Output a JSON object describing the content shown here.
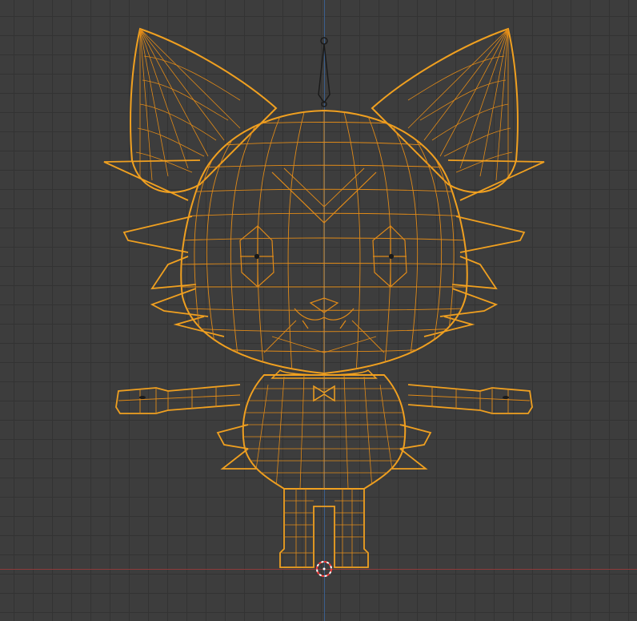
{
  "viewport": {
    "view": "front-orthographic",
    "colors": {
      "background": "#3d3d3d",
      "grid": "#333333",
      "x_axis": "#8e3a3a",
      "z_axis": "#3a5f8e",
      "wire_selected": "#f0a020",
      "wire_inner": "#e08a18",
      "armature": "#1a1a1a",
      "cursor_red": "#ff3a3a",
      "cursor_white": "#ffffff"
    }
  },
  "object": {
    "type": "character-mesh",
    "subject": "cat-mascot",
    "selected": true,
    "display": "wireframe"
  },
  "icons": {
    "cursor": "3d-cursor-icon",
    "origin": "object-origin-icon",
    "bone": "armature-bone-icon"
  }
}
